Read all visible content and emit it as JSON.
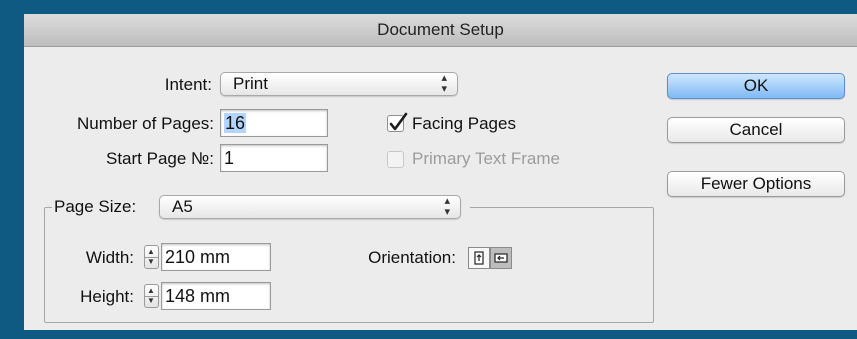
{
  "window": {
    "title": "Document Setup"
  },
  "intent": {
    "label": "Intent:",
    "value": "Print"
  },
  "pages": {
    "number_label": "Number of Pages:",
    "number_value": "16",
    "start_label": "Start Page №:",
    "start_value": "1"
  },
  "options": {
    "facing_pages": {
      "label": "Facing Pages",
      "checked": true
    },
    "primary_text_frame": {
      "label": "Primary Text Frame",
      "checked": false,
      "disabled": true
    }
  },
  "page_size": {
    "label": "Page Size:",
    "value": "A5",
    "width_label": "Width:",
    "width_value": "210 mm",
    "height_label": "Height:",
    "height_value": "148 mm",
    "orientation_label": "Orientation:",
    "orientation_selected": "landscape"
  },
  "buttons": {
    "ok": "OK",
    "cancel": "Cancel",
    "fewer_options": "Fewer Options"
  },
  "colors": {
    "background": "#0f5a82",
    "dialog": "#ececec",
    "default_button": "#7fbaf4",
    "selection": "#b3d4fc"
  }
}
